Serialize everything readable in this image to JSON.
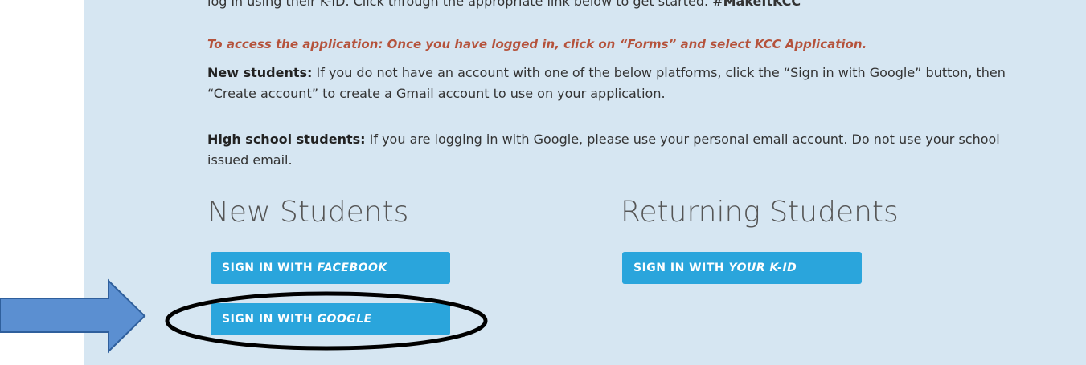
{
  "intro_cut": {
    "prefix": "log in using their K-ID. Click through the appropriate link below to get started.",
    "hashtag": "#MakeItKCC"
  },
  "notice": "To access the application: Once you have logged in, click on “Forms” and select KCC Application.",
  "new_students_note": {
    "lead": "New students:",
    "text": " If you do not have an account with one of the below platforms, click the “Sign in with Google” button, then “Create account” to create a Gmail account to use on your application."
  },
  "high_school_note": {
    "lead": "High school students:",
    "text": " If you are logging in with Google, please use your personal email account. Do not use your school issued email."
  },
  "new_students": {
    "heading": "New Students",
    "facebook_prefix": "SIGN IN WITH ",
    "facebook_em": "FACEBOOK",
    "google_prefix": "SIGN IN WITH ",
    "google_em": "GOOGLE"
  },
  "returning_students": {
    "heading": "Returning Students",
    "kid_prefix": "SIGN IN WITH ",
    "kid_em": "YOUR K-ID"
  },
  "colors": {
    "panel": "#d6e6f2",
    "button": "#2aa5dc",
    "notice": "#b5533c",
    "arrow_fill": "#5b8fd1",
    "arrow_stroke": "#2f5f9c",
    "ellipse": "#000000"
  },
  "annotations": [
    "right-arrow-icon",
    "highlight-ellipse"
  ]
}
